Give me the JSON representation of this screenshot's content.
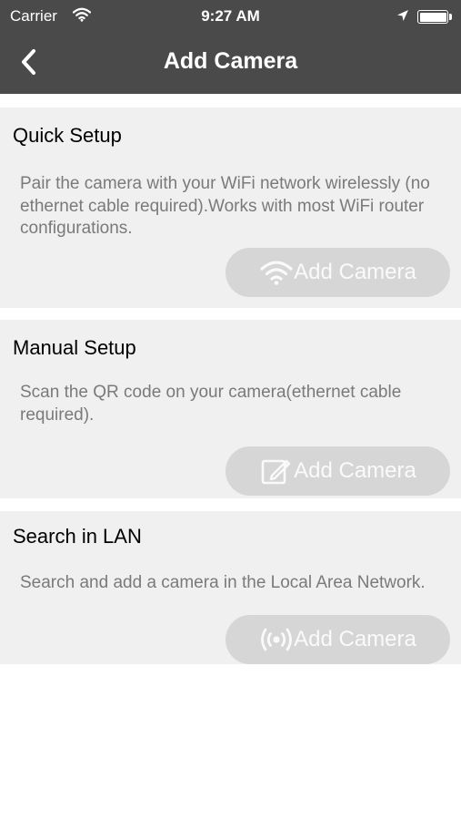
{
  "status_bar": {
    "carrier": "Carrier",
    "time": "9:27 AM"
  },
  "header": {
    "title": "Add Camera",
    "background": "#4a4a4a"
  },
  "sections": [
    {
      "title": "Quick Setup",
      "description": "Pair the camera with your WiFi network wirelessly (no ethernet cable required).Works with most WiFi router configurations.",
      "button_label": "Add Camera",
      "button_icon": "wifi-icon"
    },
    {
      "title": "Manual Setup",
      "description": "Scan the QR code on your camera(ethernet cable required).",
      "button_label": "Add Camera",
      "button_icon": "edit-icon"
    },
    {
      "title": "Search in LAN",
      "description": "Search and add a camera in the Local Area Network.",
      "button_label": "Add Camera",
      "button_icon": "broadcast-icon"
    }
  ],
  "colors": {
    "card_background": "#f0f0f0",
    "button_background": "#d6d6d6",
    "description_text": "#7a7a7a"
  }
}
